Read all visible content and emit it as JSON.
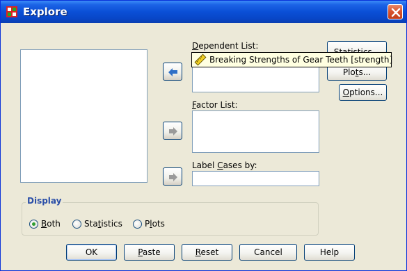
{
  "window": {
    "title": "Explore"
  },
  "dependent_list": {
    "label_pre": "",
    "label_ul": "D",
    "label_post": "ependent List:"
  },
  "factor_list": {
    "label_pre": "",
    "label_ul": "F",
    "label_post": "actor List:"
  },
  "label_cases": {
    "label_pre": "Label ",
    "label_ul": "C",
    "label_post": "ases by:"
  },
  "side_buttons": {
    "statistics": "Statistics...",
    "plots_pre": "Plo",
    "plots_ul": "t",
    "plots_post": "s...",
    "options_pre": "",
    "options_ul": "O",
    "options_post": "ptions..."
  },
  "tooltip": {
    "text": "Breaking Strengths of Gear Teeth [strength]"
  },
  "display": {
    "legend": "Display",
    "both_pre": "",
    "both_ul": "B",
    "both_post": "oth",
    "statistics_pre": "Sta",
    "statistics_ul": "t",
    "statistics_post": "istics",
    "plots_pre": "P",
    "plots_ul": "l",
    "plots_post": "ots",
    "selected": "Both"
  },
  "bottom_buttons": {
    "ok": "OK",
    "paste_pre": "",
    "paste_ul": "P",
    "paste_post": "aste",
    "reset_pre": "",
    "reset_ul": "R",
    "reset_post": "eset",
    "cancel": "Cancel",
    "help": "Help"
  },
  "colors": {
    "title_bar": "#0a4fd6",
    "legend_text": "#2b4fa8",
    "arrow_active": "#2f6fc7",
    "arrow_disabled": "#9a9a9a"
  }
}
